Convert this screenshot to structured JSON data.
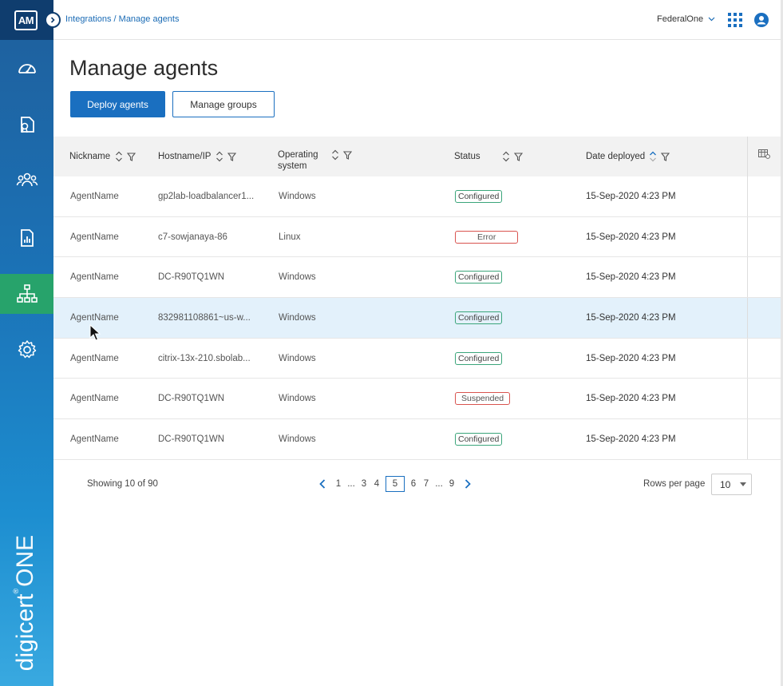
{
  "app": {
    "logo_text": "AM",
    "brand_primary": "digicert",
    "brand_secondary": "ONE"
  },
  "colors": {
    "sidebar": "#1b72b6",
    "active_nav": "#27a36b",
    "accent": "#1a6fc0",
    "configured": "#3aa57a",
    "error": "#d9534f"
  },
  "sidebar": {
    "items": [
      {
        "name": "dashboard-icon"
      },
      {
        "name": "certificate-icon"
      },
      {
        "name": "users-icon"
      },
      {
        "name": "reports-icon"
      },
      {
        "name": "integrations-icon",
        "active": true
      },
      {
        "name": "settings-icon"
      }
    ]
  },
  "header": {
    "breadcrumb": "Integrations / Manage agents",
    "org": "FederalOne",
    "apps_icon": "grid-icon",
    "user_icon": "user-icon"
  },
  "page": {
    "title": "Manage agents",
    "deploy_label": "Deploy agents",
    "groups_label": "Manage groups"
  },
  "table": {
    "columns": {
      "nickname": "Nickname",
      "hostname": "Hostname/IP",
      "os_line1": "Operating",
      "os_line2": "system",
      "status": "Status",
      "date": "Date deployed"
    },
    "rows": [
      {
        "nickname": "AgentName",
        "hostname": "gp2lab-loadbalancer1...",
        "os": "Windows",
        "status": "Configured",
        "date": "15-Sep-2020 4:23 PM"
      },
      {
        "nickname": "AgentName",
        "hostname": "c7-sowjanaya-86",
        "os": "Linux",
        "status": "Error",
        "date": "15-Sep-2020 4:23 PM"
      },
      {
        "nickname": "AgentName",
        "hostname": "DC-R90TQ1WN",
        "os": "Windows",
        "status": "Configured",
        "date": "15-Sep-2020 4:23 PM"
      },
      {
        "nickname": "AgentName",
        "hostname": "832981108861~us-w...",
        "os": "Windows",
        "status": "Configured",
        "date": "15-Sep-2020 4:23 PM"
      },
      {
        "nickname": "AgentName",
        "hostname": "citrix-13x-210.sbolab...",
        "os": "Windows",
        "status": "Configured",
        "date": "15-Sep-2020 4:23 PM"
      },
      {
        "nickname": "AgentName",
        "hostname": "DC-R90TQ1WN",
        "os": "Windows",
        "status": "Suspended",
        "date": "15-Sep-2020 4:23 PM"
      },
      {
        "nickname": "AgentName",
        "hostname": "DC-R90TQ1WN",
        "os": "Windows",
        "status": "Configured",
        "date": "15-Sep-2020 4:23 PM"
      }
    ]
  },
  "pagination": {
    "showing": "Showing 10 of 90",
    "pages": [
      "1",
      "...",
      "3",
      "4",
      "5",
      "6",
      "7",
      "...",
      "9"
    ],
    "current": "5",
    "rows_per_page_label": "Rows per page",
    "rows_per_page_value": "10"
  }
}
